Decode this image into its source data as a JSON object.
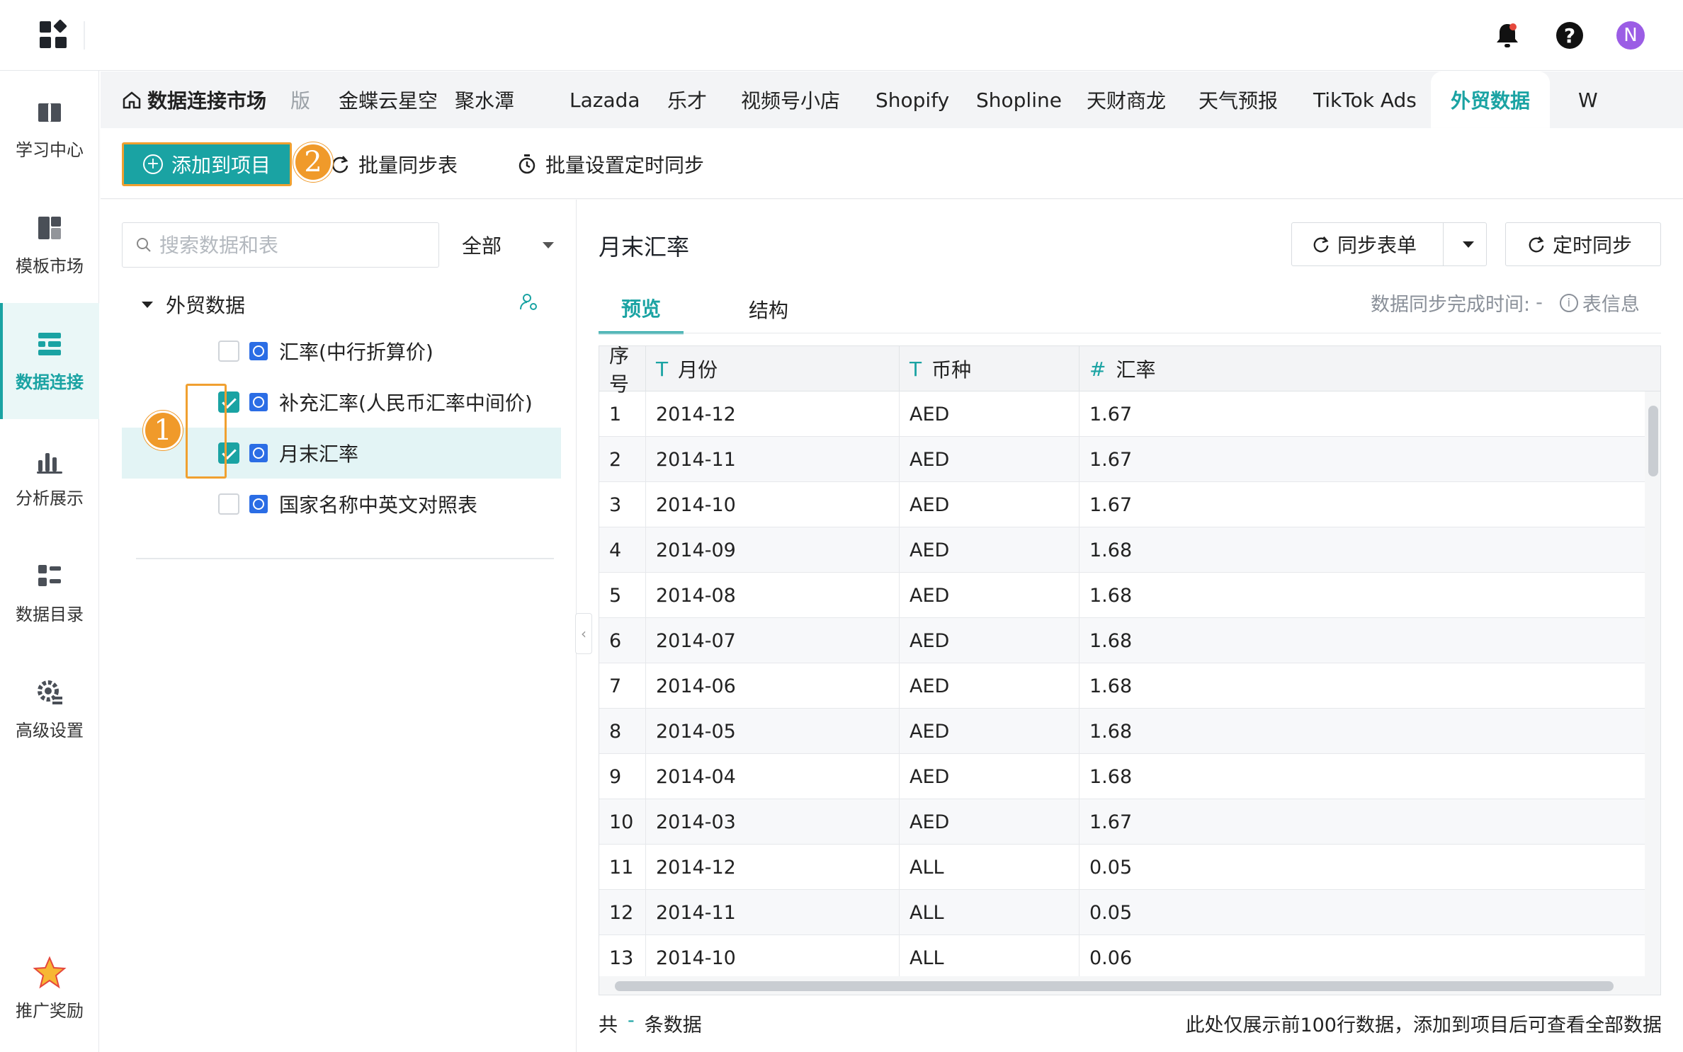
{
  "topbar": {
    "icons": [
      "apps-grid-icon",
      "bell-icon",
      "help-icon"
    ],
    "help_symbol": "?",
    "avatar_initial": "N",
    "colors": {
      "avatar": "#9b5de5",
      "accent": "#1aa3a3",
      "bell_dot": "#e5483c"
    }
  },
  "sidebar": {
    "items": [
      {
        "label": "学习中心",
        "icon": "book-icon"
      },
      {
        "label": "模板市场",
        "icon": "template-icon"
      },
      {
        "label": "数据连接",
        "icon": "data-connect-icon",
        "active": true
      },
      {
        "label": "分析展示",
        "icon": "chart-icon"
      },
      {
        "label": "数据目录",
        "icon": "catalog-icon"
      },
      {
        "label": "高级设置",
        "icon": "settings-gear-icon"
      },
      {
        "label": "推广奖励",
        "icon": "star-icon"
      }
    ]
  },
  "tabs": {
    "home": "数据连接市场",
    "items": [
      "版",
      "金蝶云星空",
      "聚水潭",
      "Lazada",
      "乐才",
      "视频号小店",
      "Shopify",
      "Shopline",
      "天财商龙",
      "天气预报",
      "TikTok Ads",
      "外贸数据",
      "W"
    ],
    "active": "外贸数据"
  },
  "toolbar": {
    "add_label": "添加到项目",
    "batch_sync_label": "批量同步表",
    "batch_schedule_label": "批量设置定时同步",
    "step_badges": [
      "1",
      "2"
    ]
  },
  "left": {
    "search_placeholder": "搜索数据和表",
    "filter_label": "全部",
    "tree_root": "外贸数据",
    "tree_items": [
      {
        "label": "汇率(中行折算价)",
        "checked": false
      },
      {
        "label": "补充汇率(人民币汇率中间价)",
        "checked": true
      },
      {
        "label": "月末汇率",
        "checked": true,
        "selected": true
      },
      {
        "label": "国家名称中英文对照表",
        "checked": false
      }
    ]
  },
  "right": {
    "title": "月末汇率",
    "sync_form_label": "同步表单",
    "schedule_sync_label": "定时同步",
    "tab_preview": "预览",
    "tab_structure": "结构",
    "sync_time_label": "数据同步完成时间:",
    "sync_time_value": "-",
    "table_info_label": "表信息",
    "table": {
      "columns": [
        {
          "name": "序号",
          "type": ""
        },
        {
          "name": "月份",
          "type": "T"
        },
        {
          "name": "币种",
          "type": "T"
        },
        {
          "name": "汇率",
          "type": "#"
        }
      ],
      "rows": [
        [
          "1",
          "2014-12",
          "AED",
          "1.67"
        ],
        [
          "2",
          "2014-11",
          "AED",
          "1.67"
        ],
        [
          "3",
          "2014-10",
          "AED",
          "1.67"
        ],
        [
          "4",
          "2014-09",
          "AED",
          "1.68"
        ],
        [
          "5",
          "2014-08",
          "AED",
          "1.68"
        ],
        [
          "6",
          "2014-07",
          "AED",
          "1.68"
        ],
        [
          "7",
          "2014-06",
          "AED",
          "1.68"
        ],
        [
          "8",
          "2014-05",
          "AED",
          "1.68"
        ],
        [
          "9",
          "2014-04",
          "AED",
          "1.68"
        ],
        [
          "10",
          "2014-03",
          "AED",
          "1.67"
        ],
        [
          "11",
          "2014-12",
          "ALL",
          "0.05"
        ],
        [
          "12",
          "2014-11",
          "ALL",
          "0.05"
        ],
        [
          "13",
          "2014-10",
          "ALL",
          "0.06"
        ]
      ]
    },
    "footer_total_prefix": "共",
    "footer_total_value": "-",
    "footer_total_suffix": "条数据",
    "footer_note": "此处仅展示前100行数据，添加到项目后可查看全部数据"
  }
}
